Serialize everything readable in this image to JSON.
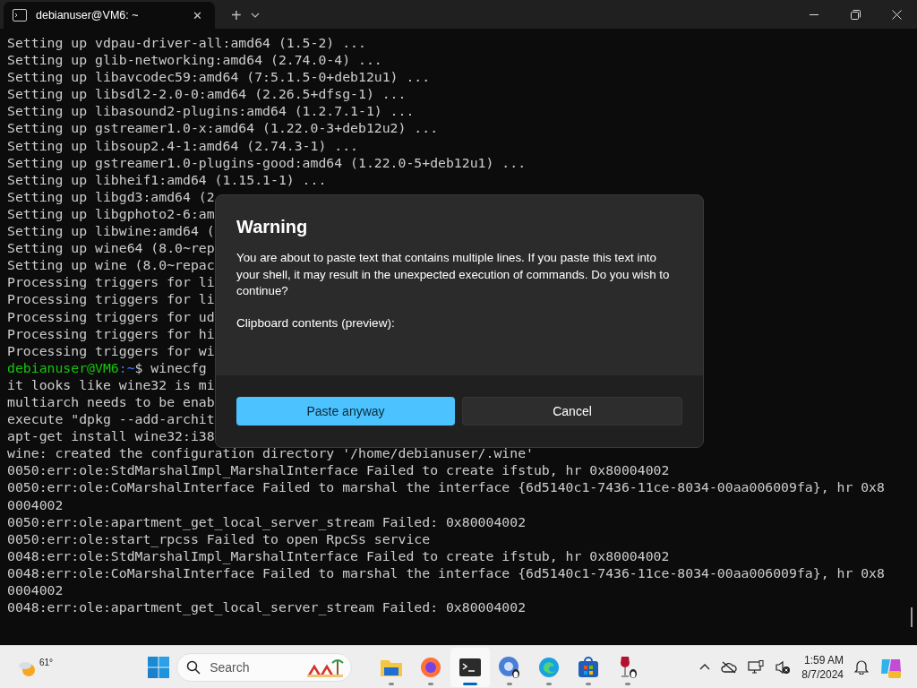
{
  "window": {
    "tab": {
      "title": "debianuser@VM6: ~",
      "close": "✕"
    },
    "new_tab": "+"
  },
  "terminal": {
    "lines": [
      {
        "kind": "output",
        "text": "Setting up vdpau-driver-all:amd64 (1.5-2) ..."
      },
      {
        "kind": "output",
        "text": "Setting up glib-networking:amd64 (2.74.0-4) ..."
      },
      {
        "kind": "output",
        "text": "Setting up libavcodec59:amd64 (7:5.1.5-0+deb12u1) ..."
      },
      {
        "kind": "output",
        "text": "Setting up libsdl2-2.0-0:amd64 (2.26.5+dfsg-1) ..."
      },
      {
        "kind": "output",
        "text": "Setting up libasound2-plugins:amd64 (1.2.7.1-1) ..."
      },
      {
        "kind": "output",
        "text": "Setting up gstreamer1.0-x:amd64 (1.22.0-3+deb12u2) ..."
      },
      {
        "kind": "output",
        "text": "Setting up libsoup2.4-1:amd64 (2.74.3-1) ..."
      },
      {
        "kind": "output",
        "text": "Setting up gstreamer1.0-plugins-good:amd64 (1.22.0-5+deb12u1) ..."
      },
      {
        "kind": "output",
        "text": "Setting up libheif1:amd64 (1.15.1-1) ..."
      },
      {
        "kind": "output",
        "text": "Setting up libgd3:amd64 (2"
      },
      {
        "kind": "output",
        "text": "Setting up libgphoto2-6:am"
      },
      {
        "kind": "output",
        "text": "Setting up libwine:amd64 ("
      },
      {
        "kind": "output",
        "text": "Setting up wine64 (8.0~rep"
      },
      {
        "kind": "output",
        "text": "Setting up wine (8.0~repac"
      },
      {
        "kind": "output",
        "text": "Processing triggers for li"
      },
      {
        "kind": "output",
        "text": "Processing triggers for li"
      },
      {
        "kind": "output",
        "text": "Processing triggers for ud"
      },
      {
        "kind": "output",
        "text": "Processing triggers for hi"
      },
      {
        "kind": "output",
        "text": "Processing triggers for wi"
      },
      {
        "kind": "prompt",
        "user": "debianuser@VM6",
        "path": ":~",
        "command": "$ winecfg"
      },
      {
        "kind": "output",
        "text": "it looks like wine32 is mi"
      },
      {
        "kind": "output",
        "text": "multiarch needs to be enab"
      },
      {
        "kind": "output",
        "text": "execute \"dpkg --add-archit"
      },
      {
        "kind": "output",
        "text": "apt-get install wine32:i38"
      },
      {
        "kind": "output",
        "text": "wine: created the configuration directory '/home/debianuser/.wine'"
      },
      {
        "kind": "output",
        "text": "0050:err:ole:StdMarshalImpl_MarshalInterface Failed to create ifstub, hr 0x80004002"
      },
      {
        "kind": "output",
        "text": "0050:err:ole:CoMarshalInterface Failed to marshal the interface {6d5140c1-7436-11ce-8034-00aa006009fa}, hr 0x8"
      },
      {
        "kind": "output",
        "text": "0004002"
      },
      {
        "kind": "output",
        "text": "0050:err:ole:apartment_get_local_server_stream Failed: 0x80004002"
      },
      {
        "kind": "output",
        "text": "0050:err:ole:start_rpcss Failed to open RpcSs service"
      },
      {
        "kind": "output",
        "text": "0048:err:ole:StdMarshalImpl_MarshalInterface Failed to create ifstub, hr 0x80004002"
      },
      {
        "kind": "output",
        "text": "0048:err:ole:CoMarshalInterface Failed to marshal the interface {6d5140c1-7436-11ce-8034-00aa006009fa}, hr 0x8"
      },
      {
        "kind": "output",
        "text": "0004002"
      },
      {
        "kind": "output",
        "text": "0048:err:ole:apartment_get_local_server_stream Failed: 0x80004002"
      }
    ]
  },
  "dialog": {
    "title": "Warning",
    "message": "You are about to paste text that contains multiple lines. If you paste this text into your shell, it may result in the unexpected execution of commands. Do you wish to continue?",
    "preview_label": "Clipboard contents (preview):",
    "buttons": [
      {
        "label": "Paste anyway",
        "kind": "primary"
      },
      {
        "label": "Cancel",
        "kind": "secondary"
      }
    ]
  },
  "taskbar": {
    "weather": "61°",
    "search": {
      "placeholder": "Search"
    },
    "apps": [
      {
        "kind": "files",
        "active": false
      },
      {
        "kind": "firefox",
        "active": false
      },
      {
        "kind": "terminal",
        "active": true
      },
      {
        "kind": "chrome-linux",
        "active": false
      },
      {
        "kind": "edge",
        "active": false
      },
      {
        "kind": "store",
        "active": false
      },
      {
        "kind": "wine",
        "active": false
      }
    ],
    "time": "1:59 AM",
    "date": "8/7/2024"
  }
}
